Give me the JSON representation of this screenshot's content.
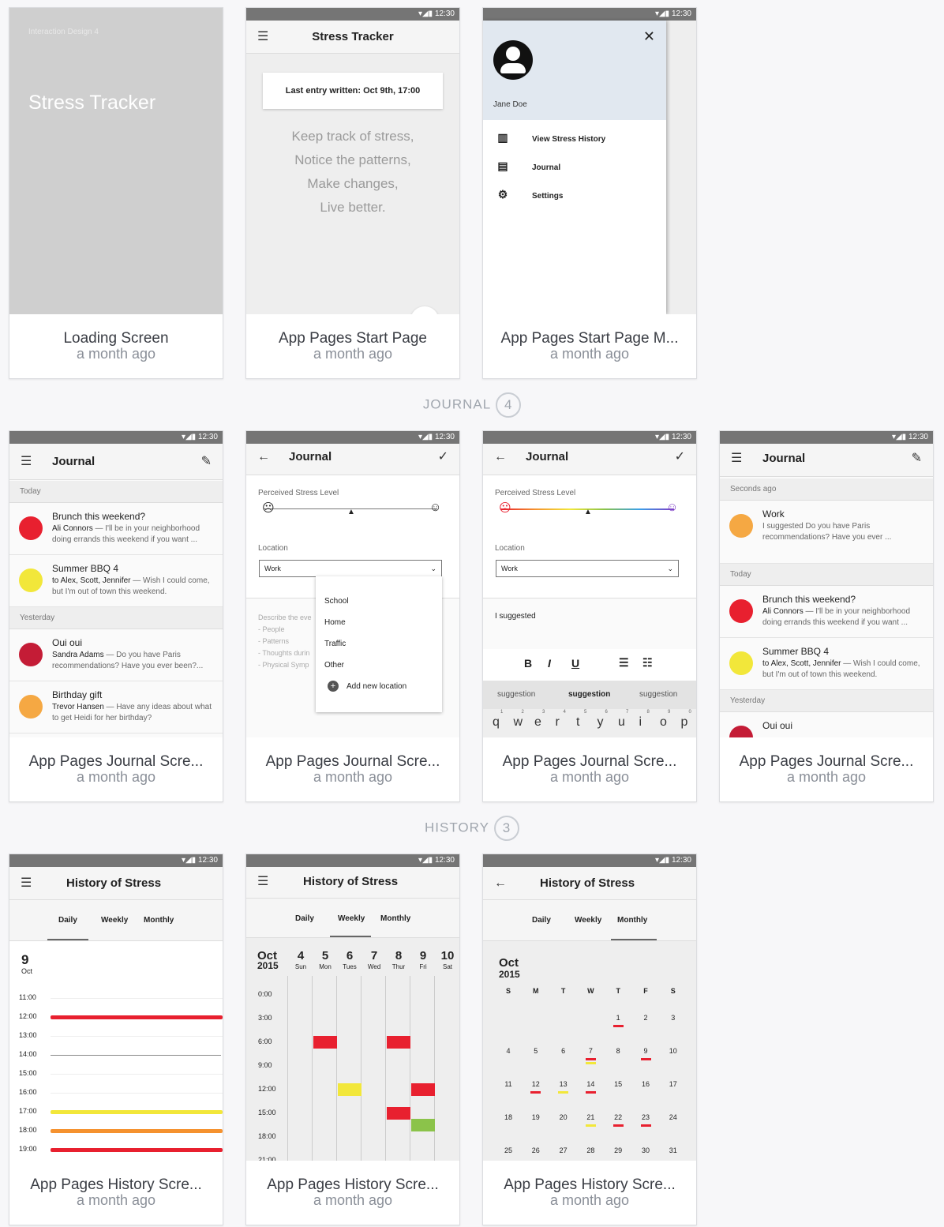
{
  "cards": [
    {
      "title": "Loading Screen",
      "time": "a month ago"
    },
    {
      "title": "App Pages Start Page",
      "time": "a month ago"
    },
    {
      "title": "App Pages Start Page M...",
      "time": "a month ago"
    },
    {
      "title": "App Pages Journal Scre...",
      "time": "a month ago"
    },
    {
      "title": "App Pages Journal Scre...",
      "time": "a month ago"
    },
    {
      "title": "App Pages Journal Scre...",
      "time": "a month ago"
    },
    {
      "title": "App Pages Journal Scre...",
      "time": "a month ago"
    },
    {
      "title": "App Pages History Scre...",
      "time": "a month ago"
    },
    {
      "title": "App Pages History Scre...",
      "time": "a month ago"
    },
    {
      "title": "App Pages History Scre...",
      "time": "a month ago"
    }
  ],
  "sections": [
    {
      "name": "JOURNAL",
      "count": "4"
    },
    {
      "name": "HISTORY",
      "count": "3"
    }
  ],
  "status_time": "12:30",
  "loading": {
    "course": "Interaction Design 4",
    "app": "Stress Tracker"
  },
  "start": {
    "title": "Stress Tracker",
    "last_entry": "Last entry written: Oct 9th, 17:00",
    "slogan": [
      "Keep track of stress,",
      "Notice the patterns,",
      "Make changes,",
      "Live better."
    ]
  },
  "drawer": {
    "user": "Jane Doe",
    "items": [
      "View Stress History",
      "Journal",
      "Settings"
    ]
  },
  "journal": {
    "title": "Journal",
    "today": "Today",
    "yesterday": "Yesterday",
    "seconds_ago": "Seconds ago",
    "entries": [
      {
        "title": "Brunch this weekend?",
        "who": "Ali Connors",
        "text": " — I'll be in your neighborhood doing errands this weekend if you want ...",
        "color": "#e8202f"
      },
      {
        "title": "Summer BBQ  4",
        "who": "to Alex, Scott, Jennifer",
        "text": " — Wish I could come, but I'm out of town this weekend.",
        "color": "#f2e73a"
      },
      {
        "title": "Oui oui",
        "who": "Sandra Adams",
        "text": " — Do you have Paris recommendations? Have you ever been?...",
        "color": "#c41c36"
      },
      {
        "title": "Birthday gift",
        "who": "Trevor Hansen",
        "text": " — Have any ideas about what to get Heidi for her birthday?",
        "color": "#f5a843"
      }
    ],
    "new_entry": {
      "title": "Work",
      "text": "I suggested Do you have Paris recommendations? Have you ever ...",
      "color": "#f5a843"
    },
    "stress_label": "Perceived Stress Level",
    "location_label": "Location",
    "location_value": "Work",
    "dropdown": [
      "School",
      "Home",
      "Traffic",
      "Other"
    ],
    "add_location": "Add new location",
    "describe": [
      "Describe the eve",
      "- People",
      "- Patterns",
      "- Thoughts durin",
      "- Physical Symp"
    ],
    "typed": "I suggested",
    "suggestions": [
      "suggestion",
      "suggestion",
      "suggestion"
    ],
    "keys": [
      "q",
      "w",
      "e",
      "r",
      "t",
      "y",
      "u",
      "i",
      "o",
      "p"
    ],
    "key_nums": [
      "1",
      "2",
      "3",
      "4",
      "5",
      "6",
      "7",
      "8",
      "9",
      "0"
    ]
  },
  "history": {
    "title": "History of Stress",
    "tabs": [
      "Daily",
      "Weekly",
      "Monthly"
    ],
    "daily": {
      "day": "9",
      "month": "Oct",
      "hours": [
        "11:00",
        "12:00",
        "13:00",
        "14:00",
        "15:00",
        "16:00",
        "17:00",
        "18:00",
        "19:00"
      ],
      "levels": [
        null,
        "#e8202f",
        null,
        "line",
        null,
        null,
        "#f2e73a",
        "#f5922f",
        "#e8202f"
      ]
    },
    "weekly": {
      "month": "Oct",
      "year": "2015",
      "days": [
        {
          "n": "4",
          "d": "Sun"
        },
        {
          "n": "5",
          "d": "Mon"
        },
        {
          "n": "6",
          "d": "Tues"
        },
        {
          "n": "7",
          "d": "Wed"
        },
        {
          "n": "8",
          "d": "Thur"
        },
        {
          "n": "9",
          "d": "Fri"
        },
        {
          "n": "10",
          "d": "Sat"
        }
      ],
      "times": [
        "0:00",
        "3:00",
        "6:00",
        "9:00",
        "12:00",
        "15:00",
        "18:00",
        "21:00"
      ],
      "blocks": [
        {
          "day": 1,
          "slot": 2,
          "color": "#e8202f"
        },
        {
          "day": 4,
          "slot": 2,
          "color": "#e8202f"
        },
        {
          "day": 2,
          "slot": 4,
          "color": "#f2e73a"
        },
        {
          "day": 5,
          "slot": 4,
          "color": "#e8202f"
        },
        {
          "day": 4,
          "slot": 5,
          "color": "#e8202f"
        },
        {
          "day": 5,
          "slot": 5.5,
          "color": "#8bc34a"
        }
      ]
    },
    "monthly": {
      "month": "Oct",
      "year": "2015",
      "weekdays": [
        "S",
        "M",
        "T",
        "W",
        "T",
        "F",
        "S"
      ],
      "weeks": [
        [
          "",
          "",
          "",
          "",
          "1",
          "2",
          "3"
        ],
        [
          "4",
          "5",
          "6",
          "7",
          "8",
          "9",
          "10"
        ],
        [
          "11",
          "12",
          "13",
          "14",
          "15",
          "16",
          "17"
        ],
        [
          "18",
          "19",
          "20",
          "21",
          "22",
          "23",
          "24"
        ],
        [
          "25",
          "26",
          "27",
          "28",
          "29",
          "30",
          "31"
        ]
      ],
      "marks": {
        "1": [
          "#e8202f"
        ],
        "7": [
          "#e8202f",
          "#f2e73a"
        ],
        "9": [
          "#e8202f"
        ],
        "12": [
          "#e8202f"
        ],
        "13": [
          "#f2e73a"
        ],
        "14": [
          "#e8202f"
        ],
        "21": [
          "#f2e73a"
        ],
        "22": [
          "#e8202f"
        ],
        "23": [
          "#e8202f"
        ]
      }
    }
  }
}
